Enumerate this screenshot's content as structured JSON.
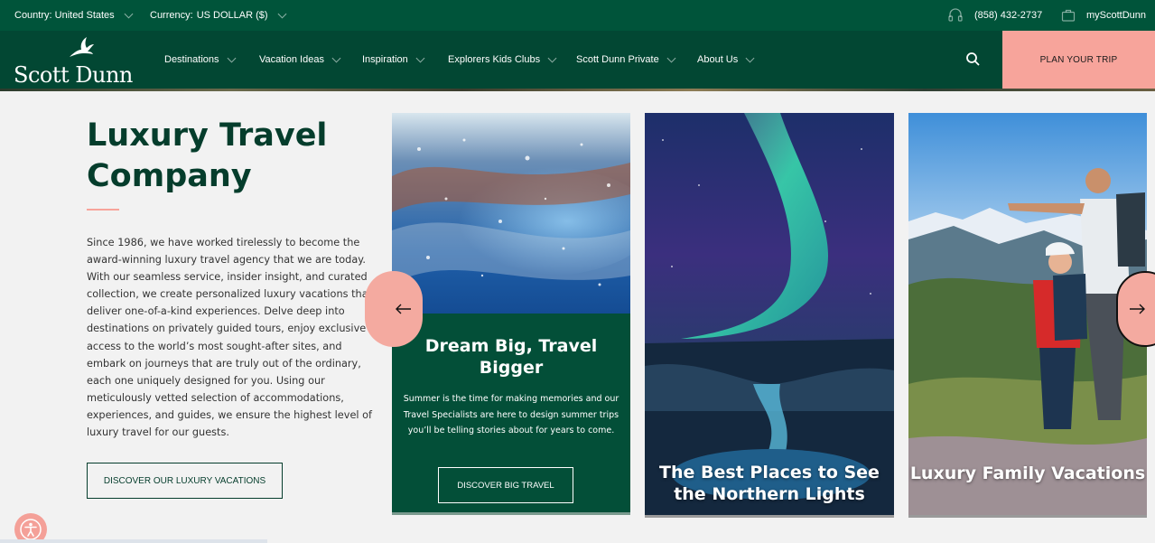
{
  "topbar": {
    "country_label": "Country: United States",
    "currency_label": "Currency:",
    "currency_value": "US DOLLAR ($)",
    "phone": "(858) 432-2737",
    "account": "myScottDunn"
  },
  "brand": {
    "name": "Scott Dunn"
  },
  "nav": {
    "items": [
      {
        "label": "Destinations"
      },
      {
        "label": "Vacation Ideas"
      },
      {
        "label": "Inspiration"
      },
      {
        "label": "Explorers Kids Clubs"
      },
      {
        "label": "Scott Dunn Private"
      },
      {
        "label": "About Us"
      }
    ],
    "cta": "PLAN YOUR TRIP"
  },
  "intro": {
    "title": "Luxury Travel Company",
    "body": "Since 1986, we have worked tirelessly to become the award-winning luxury travel agency that we are today. With our seamless service, insider insight, and curated collection, we create personalized luxury vacations that deliver one-of-a-kind experiences. Delve deep into destinations on privately guided tours, enjoy exclusive access to the world’s most sought-after sites, and embark on journeys that are truly out of the ordinary, each one uniquely designed for you. Using our meticulously vetted selection of accommodations, experiences, and guides, we ensure the highest level of luxury travel for our guests.",
    "button": "DISCOVER OUR LUXURY VACATIONS"
  },
  "cards": [
    {
      "title": "Dream Big, Travel Bigger",
      "body": "Summer is the time for making memories and our Travel Specialists are here to design summer trips you’ll be telling stories about for years to come.",
      "button": "DISCOVER BIG TRAVEL"
    },
    {
      "title": "The Best Places to See the Northern Lights"
    },
    {
      "title": "Luxury Family Vacations"
    }
  ],
  "colors": {
    "topbar": "#00543a",
    "nav": "#024733",
    "accent": "#f7a49b",
    "heading": "#053d2c"
  },
  "icons": {
    "phone": "headset-icon",
    "account": "suitcase-icon",
    "search": "search-icon",
    "prev": "arrow-left-icon",
    "next": "arrow-right-icon",
    "accessibility": "accessibility-icon"
  }
}
